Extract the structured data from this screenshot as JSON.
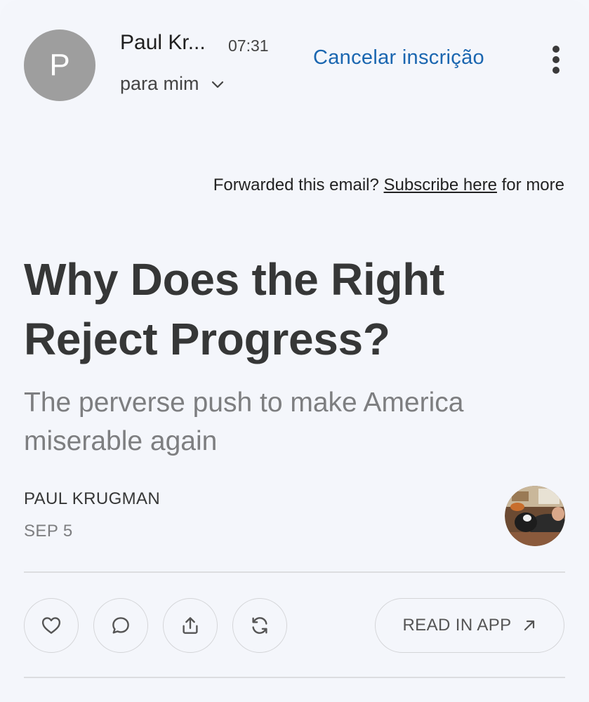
{
  "header": {
    "avatar_letter": "P",
    "sender": "Paul Kr...",
    "time": "07:31",
    "recipient": "para mim",
    "unsubscribe_label": "Cancelar inscrição"
  },
  "forward_notice": {
    "prefix": "Forwarded this email? ",
    "link": "Subscribe here",
    "suffix": " for more"
  },
  "post": {
    "title": "Why Does the Right Reject Progress?",
    "subtitle": "The perverse push to make America miserable again",
    "author": "PAUL KRUGMAN",
    "date": "SEP 5"
  },
  "actions": {
    "read_in_app_label": "READ IN APP",
    "icons": [
      "heart-icon",
      "comment-icon",
      "share-icon",
      "restack-icon",
      "arrow-up-right-icon"
    ]
  },
  "colors": {
    "accent_link": "#1a66b0",
    "avatar_bg": "#9e9e9e",
    "title_text": "#363737",
    "subtitle_text": "#7d7e80"
  }
}
